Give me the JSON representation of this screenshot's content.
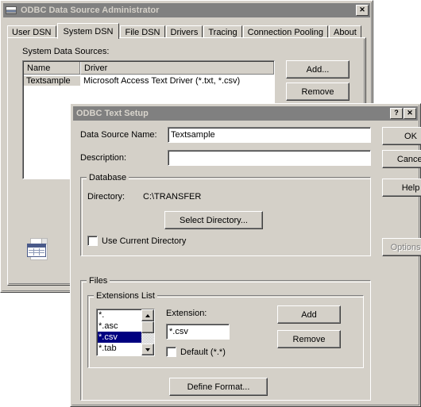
{
  "main_window": {
    "title": "ODBC Data Source Administrator",
    "icon": "odbc-icon",
    "close_label": "✕",
    "tabs": [
      {
        "label": "User DSN",
        "active": false
      },
      {
        "label": "System DSN",
        "active": true
      },
      {
        "label": "File DSN",
        "active": false
      },
      {
        "label": "Drivers",
        "active": false
      },
      {
        "label": "Tracing",
        "active": false
      },
      {
        "label": "Connection Pooling",
        "active": false
      },
      {
        "label": "About",
        "active": false
      }
    ],
    "list_caption": "System Data Sources:",
    "columns": [
      "Name",
      "Driver"
    ],
    "rows": [
      {
        "name": "Textsample",
        "driver": "Microsoft Access Text Driver (*.txt, *.csv)"
      }
    ],
    "buttons": {
      "add": "Add...",
      "remove": "Remove"
    }
  },
  "text_setup": {
    "title": "ODBC Text Setup",
    "help_label": "?",
    "close_label": "✕",
    "data_source_name_label": "Data Source Name:",
    "data_source_name_value": "Textsample",
    "description_label": "Description:",
    "description_value": "",
    "database_group": "Database",
    "directory_label": "Directory:",
    "directory_value": "C:\\TRANSFER",
    "select_directory_button": "Select Directory...",
    "use_current_directory_label": "Use Current Directory",
    "use_current_directory_checked": false,
    "files_group": "Files",
    "extensions_group": "Extensions List",
    "extensions": [
      {
        "label": "*.",
        "selected": false
      },
      {
        "label": "*.asc",
        "selected": false
      },
      {
        "label": "*.csv",
        "selected": true
      },
      {
        "label": "*.tab",
        "selected": false
      }
    ],
    "extension_label": "Extension:",
    "extension_value": "*.csv",
    "default_label": "Default (*.*)",
    "default_checked": false,
    "files_add_button": "Add",
    "files_remove_button": "Remove",
    "define_format_button": "Define Format...",
    "ok_button": "OK",
    "cancel_button": "Cancel",
    "help_button": "Help",
    "options_button": "Options>>",
    "options_disabled": true
  },
  "colors": {
    "face": "#d4d0c8",
    "titlebar_inactive": "#808080",
    "selection": "#000080",
    "window": "#ffffff"
  }
}
